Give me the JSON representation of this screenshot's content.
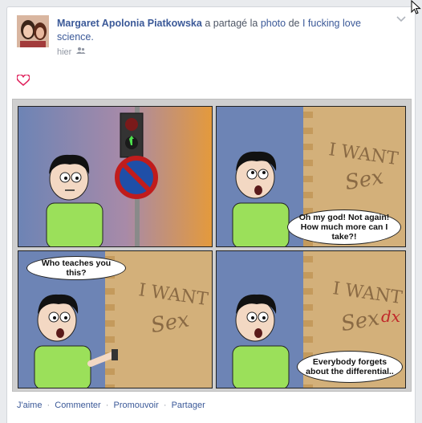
{
  "post": {
    "author": "Margaret Apolonia Piatkowska",
    "verb": " a partagé la ",
    "object_link": "photo",
    "preposition": " de ",
    "page_name": "I fucking love science.",
    "time": "hier",
    "audience_icon": "friends-icon"
  },
  "comic": {
    "panel2_bubble": "Oh my god! Not again! How much more can I take?!",
    "panel3_bubble": "Who teaches you this?",
    "panel4_bubble": "Everybody forgets about the differential..",
    "wall_text_line1": "I WANT",
    "wall_text_line2": "Sex",
    "wall_text_dx": "dx"
  },
  "actions": {
    "like": "J'aime",
    "comment": "Commenter",
    "promote": "Promouvoir",
    "share": "Partager",
    "separator": "·"
  },
  "colors": {
    "link": "#3b5998",
    "muted": "#9197a3",
    "heart": "#e0245e",
    "dx_red": "#c0282a"
  }
}
